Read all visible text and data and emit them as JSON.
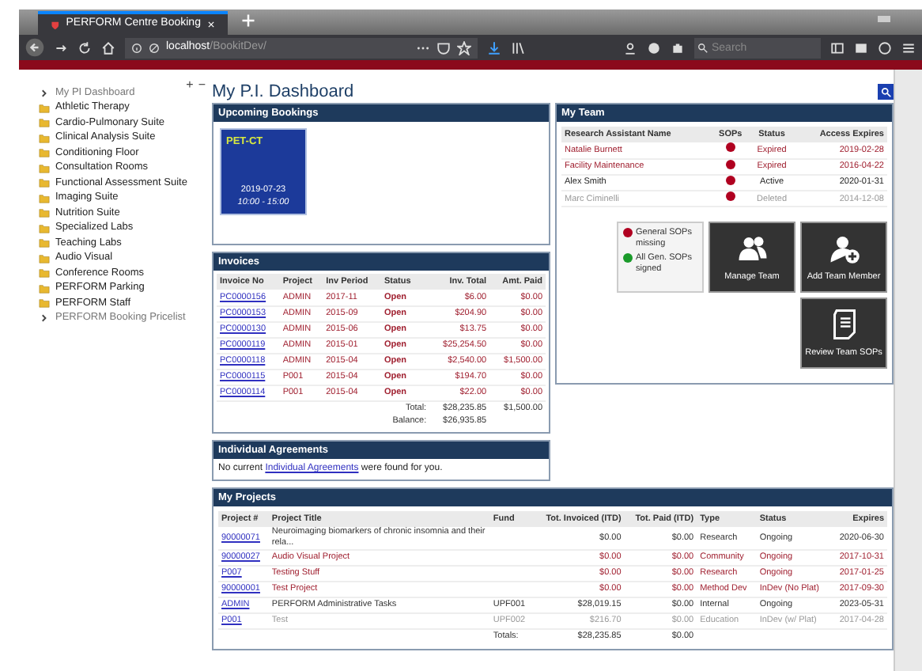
{
  "browser": {
    "tab_title": "PERFORM Centre Booking",
    "url_host": "localhost",
    "url_path": "/BookitDev/",
    "search_placeholder": "Search"
  },
  "sidebar": {
    "items": [
      {
        "label": "My PI Dashboard",
        "kind": "link"
      },
      {
        "label": "Athletic Therapy",
        "kind": "folder"
      },
      {
        "label": "Cardio-Pulmonary Suite",
        "kind": "folder"
      },
      {
        "label": "Clinical Analysis Suite",
        "kind": "folder"
      },
      {
        "label": "Conditioning Floor",
        "kind": "folder"
      },
      {
        "label": "Consultation Rooms",
        "kind": "folder"
      },
      {
        "label": "Functional Assessment Suite",
        "kind": "folder"
      },
      {
        "label": "Imaging Suite",
        "kind": "folder"
      },
      {
        "label": "Nutrition Suite",
        "kind": "folder"
      },
      {
        "label": "Specialized Labs",
        "kind": "folder"
      },
      {
        "label": "Teaching Labs",
        "kind": "folder"
      },
      {
        "label": "Audio Visual",
        "kind": "folder"
      },
      {
        "label": "Conference Rooms",
        "kind": "folder"
      },
      {
        "label": "PERFORM Parking",
        "kind": "folder"
      },
      {
        "label": "PERFORM Staff",
        "kind": "folder"
      },
      {
        "label": "PERFORM Booking Pricelist",
        "kind": "link"
      }
    ],
    "expand": "+",
    "collapse": "−"
  },
  "page_title": "My P.I. Dashboard",
  "upcoming": {
    "title": "Upcoming Bookings",
    "bookings": [
      {
        "name": "PET-CT",
        "date": "2019-07-23",
        "time": "10:00 - 15:00"
      }
    ]
  },
  "invoices": {
    "title": "Invoices",
    "columns": [
      "Invoice No",
      "Project",
      "Inv Period",
      "Status",
      "Inv. Total",
      "Amt. Paid"
    ],
    "rows": [
      [
        "PC0000156",
        "ADMIN",
        "2017-11",
        "Open",
        "$6.00",
        "$0.00"
      ],
      [
        "PC0000153",
        "ADMIN",
        "2015-09",
        "Open",
        "$204.90",
        "$0.00"
      ],
      [
        "PC0000130",
        "ADMIN",
        "2015-06",
        "Open",
        "$13.75",
        "$0.00"
      ],
      [
        "PC0000119",
        "ADMIN",
        "2015-01",
        "Open",
        "$25,254.50",
        "$0.00"
      ],
      [
        "PC0000118",
        "ADMIN",
        "2015-04",
        "Open",
        "$2,540.00",
        "$1,500.00"
      ],
      [
        "PC0000115",
        "P001",
        "2015-04",
        "Open",
        "$194.70",
        "$0.00"
      ],
      [
        "PC0000114",
        "P001",
        "2015-04",
        "Open",
        "$22.00",
        "$0.00"
      ]
    ],
    "total_label": "Total:",
    "total_inv": "$28,235.85",
    "total_paid": "$1,500.00",
    "balance_label": "Balance:",
    "balance": "$26,935.85"
  },
  "agreements": {
    "title": "Individual Agreements",
    "before": "No current ",
    "link": "Individual Agreements",
    "after": " were found for you."
  },
  "team": {
    "title": "My Team",
    "columns": [
      "Research Assistant Name",
      "SOPs",
      "Status",
      "Access Expires"
    ],
    "rows": [
      {
        "name": "Natalie Burnett",
        "sops_signed": false,
        "status": "Expired",
        "expires": "2019-02-28",
        "kind": "expired"
      },
      {
        "name": "Facility Maintenance",
        "sops_signed": false,
        "status": "Expired",
        "expires": "2016-04-22",
        "kind": "expired"
      },
      {
        "name": "Alex Smith",
        "sops_signed": false,
        "status": "Active",
        "expires": "2020-01-31",
        "kind": "active"
      },
      {
        "name": "Marc Ciminelli",
        "sops_signed": false,
        "status": "Deleted",
        "expires": "2014-12-08",
        "kind": "deleted"
      }
    ],
    "legend": [
      {
        "label": "General SOPs missing",
        "color": "#b00020"
      },
      {
        "label": "All Gen. SOPs signed",
        "color": "#1a9a2a"
      }
    ],
    "actions": [
      {
        "label": "Manage Team",
        "kind": "team"
      },
      {
        "label": "Add Team Member",
        "kind": "add"
      },
      {
        "label": "Review Team SOPs",
        "kind": "review"
      }
    ]
  },
  "projects": {
    "title": "My Projects",
    "columns": [
      "Project #",
      "Project Title",
      "Fund",
      "Tot. Invoiced (ITD)",
      "Tot. Paid (ITD)",
      "Type",
      "Status",
      "Expires"
    ],
    "rows": [
      {
        "kind": "normal",
        "cells": [
          "90000071",
          "Neuroimaging biomarkers of chronic insomnia and their rela...",
          "",
          "$0.00",
          "$0.00",
          "Research",
          "Ongoing",
          "2020-06-30"
        ]
      },
      {
        "kind": "expired",
        "cells": [
          "90000027",
          "Audio Visual Project",
          "",
          "$0.00",
          "$0.00",
          "Community",
          "Ongoing",
          "2017-10-31"
        ]
      },
      {
        "kind": "expired",
        "cells": [
          "P007",
          "Testing Stuff",
          "",
          "$0.00",
          "$0.00",
          "Research",
          "Ongoing",
          "2017-01-25"
        ]
      },
      {
        "kind": "expired",
        "cells": [
          "90000001",
          "Test Project",
          "",
          "$0.00",
          "$0.00",
          "Method Dev",
          "InDev (No Plat)",
          "2017-09-30"
        ]
      },
      {
        "kind": "normal",
        "cells": [
          "ADMIN",
          "PERFORM Administrative Tasks",
          "UPF001",
          "$28,019.15",
          "$0.00",
          "Internal",
          "Ongoing",
          "2023-05-31"
        ]
      },
      {
        "kind": "inactive",
        "cells": [
          "P001",
          "Test",
          "UPF002",
          "$216.70",
          "$0.00",
          "Education",
          "InDev (w/ Plat)",
          "2017-04-28"
        ]
      }
    ],
    "totals_label": "Totals:",
    "total_invoiced": "$28,235.85",
    "total_paid": "$0.00"
  }
}
